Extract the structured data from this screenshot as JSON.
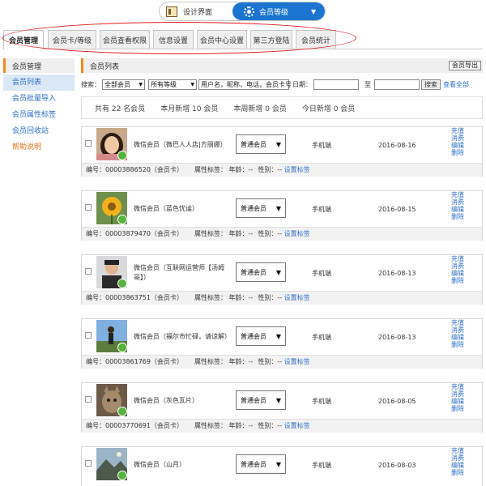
{
  "top_switch": {
    "left_label": "设计界面",
    "right_label": "会员等级"
  },
  "tabs": [
    {
      "label": "会员管理",
      "active": true
    },
    {
      "label": "会员卡/等级"
    },
    {
      "label": "会员查看权限"
    },
    {
      "label": "信息设置"
    },
    {
      "label": "会员中心设置"
    },
    {
      "label": "第三方登陆"
    },
    {
      "label": "会员统计"
    }
  ],
  "sidebar": {
    "heading": "会员管理",
    "items": [
      "会员列表",
      "会员批量导入",
      "会员属性标签",
      "会员回收站",
      "帮助说明"
    ]
  },
  "main": {
    "heading": "会员列表",
    "export_label": "会员导出"
  },
  "search": {
    "label": "搜索：",
    "member_select": "全部会员",
    "level_select": "所有等级",
    "keyword_placeholder": "用户名，昵称，电话，会员卡号",
    "date_label": "日期：",
    "to_label": "至",
    "search_button": "搜索",
    "view_all": "查看全部"
  },
  "stats": {
    "total": "共有 22 名会员",
    "month": "本月新增 10 会员",
    "week": "本周新增 0 会员",
    "today": "今日新增 0 会员"
  },
  "labels": {
    "number_prefix": "编号：",
    "card_suffix": "（会员卡）",
    "attr_tag": "属性标签：",
    "age": "年龄：--",
    "gender": "性别：--",
    "set_tag": "设置标签"
  },
  "actions": [
    "充值",
    "消费",
    "编辑",
    "删除"
  ],
  "members": [
    {
      "nickname": "微信会员（微巴人人店|方丽娜）",
      "level": "普通会员",
      "device": "手机端",
      "date": "2016-08-16",
      "number": "00003886520",
      "avatar": "avatar-woman"
    },
    {
      "nickname": "微信会员（蓝色忧谧）",
      "level": "普通会员",
      "device": "手机端",
      "date": "2016-08-15",
      "number": "00003879470",
      "avatar": "avatar-flower"
    },
    {
      "nickname": "微信会员（互联网运营师【汤姆哥】）",
      "level": "普通会员",
      "device": "手机端",
      "date": "2016-08-13",
      "number": "00003863751",
      "avatar": "avatar-man"
    },
    {
      "nickname": "微信会员（福尔市忙碌，请谅解）",
      "level": "普通会员",
      "device": "手机端",
      "date": "2016-08-13",
      "number": "00003861769",
      "avatar": "avatar-outdoor"
    },
    {
      "nickname": "微信会员（灰色瓦片）",
      "level": "普通会员",
      "device": "手机端",
      "date": "2016-08-05",
      "number": "00003770691",
      "avatar": "avatar-cat"
    },
    {
      "nickname": "微信会员（山月）",
      "level": "普通会员",
      "device": "手机端",
      "date": "2016-08-03",
      "number": "",
      "avatar": "avatar-landscape"
    }
  ]
}
